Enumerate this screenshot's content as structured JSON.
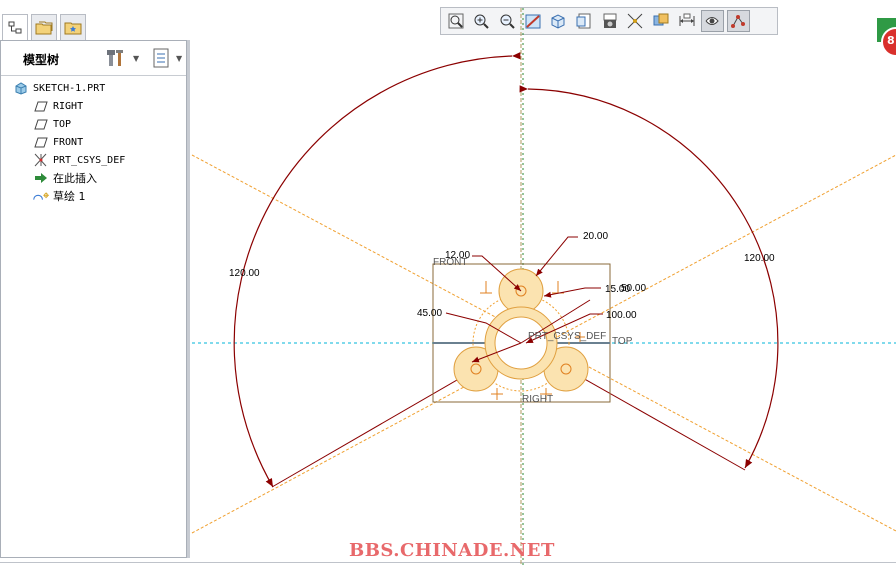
{
  "model_tree": {
    "title": "模型树",
    "items": [
      {
        "label": "SKETCH-1.PRT",
        "icon": "part-icon"
      },
      {
        "label": "RIGHT",
        "icon": "datum-plane-icon"
      },
      {
        "label": "TOP",
        "icon": "datum-plane-icon"
      },
      {
        "label": "FRONT",
        "icon": "datum-plane-icon"
      },
      {
        "label": "PRT_CSYS_DEF",
        "icon": "csys-icon"
      },
      {
        "label": "在此插入",
        "icon": "insert-arrow-icon"
      },
      {
        "label": "草绘 1",
        "icon": "sketch-icon"
      }
    ]
  },
  "canvas": {
    "datum_labels": {
      "front": "FRONT",
      "top": "TOP",
      "right": "RIGHT",
      "csys": "PRT_CSYS_DEF"
    },
    "dimensions": {
      "left_angle": "120.00",
      "right_angle": "120.00",
      "d1": "12.00",
      "d2": "20.00",
      "d3": "15.00",
      "d4": "50.00",
      "d5": "45.00",
      "d6": "100.00"
    },
    "colors": {
      "dimension": "#8b0000",
      "centerline": "#f0a030",
      "datum": "#00b4d8",
      "sketch_fill": "#fbe3b0"
    }
  },
  "watermark": "BBS.CHINADE.NET",
  "badge": {
    "text": "8",
    "color": "#d9302c"
  }
}
